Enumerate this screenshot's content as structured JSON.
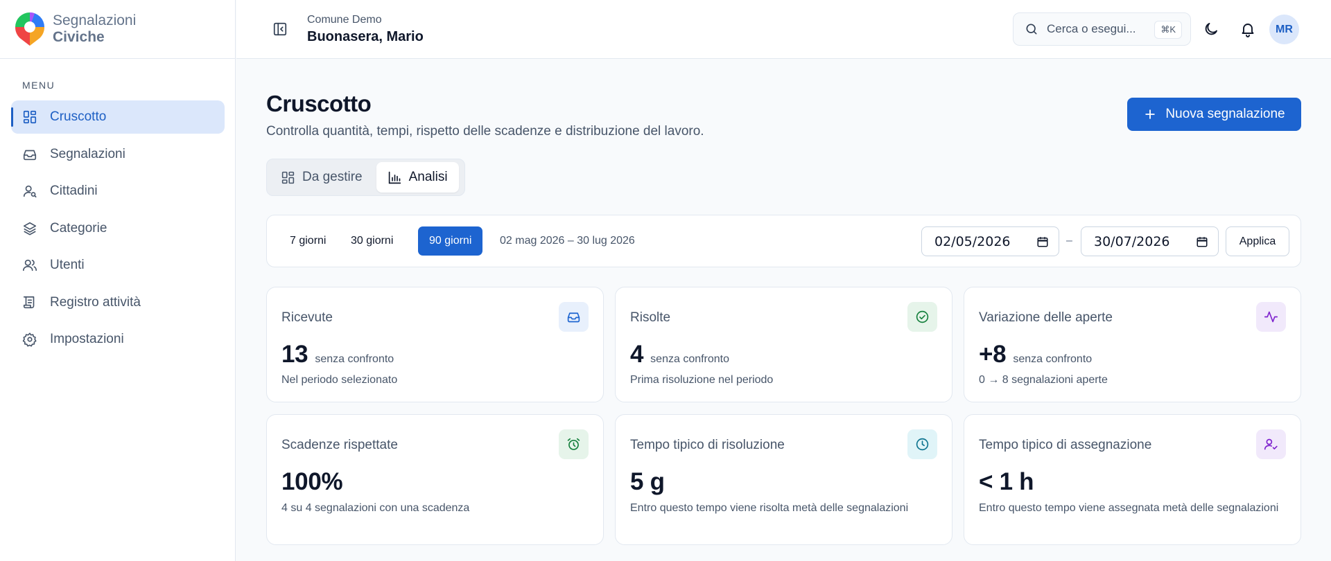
{
  "brand": {
    "line1": "Segnalazioni",
    "line2": "Civiche"
  },
  "sidebar": {
    "menu_label": "MENU",
    "items": [
      {
        "label": "Cruscotto",
        "icon": "dashboard-icon",
        "active": true
      },
      {
        "label": "Segnalazioni",
        "icon": "inbox-icon",
        "active": false
      },
      {
        "label": "Cittadini",
        "icon": "citizen-search-icon",
        "active": false
      },
      {
        "label": "Categorie",
        "icon": "layers-icon",
        "active": false
      },
      {
        "label": "Utenti",
        "icon": "users-icon",
        "active": false
      },
      {
        "label": "Registro attività",
        "icon": "log-scroll-icon",
        "active": false
      },
      {
        "label": "Impostazioni",
        "icon": "gear-icon",
        "active": false
      }
    ]
  },
  "header": {
    "org": "Comune Demo",
    "user": "Buonasera, Mario",
    "search_placeholder": "Cerca o esegui...",
    "shortcut": "⌘K",
    "avatar_initials": "MR"
  },
  "main": {
    "title": "Cruscotto",
    "subtitle": "Controlla quantità, tempi, rispetto delle scadenze e distribuzione del lavoro.",
    "new_button": "Nuova segnalazione",
    "view_tabs": [
      {
        "label": "Da gestire",
        "active": false
      },
      {
        "label": "Analisi",
        "active": true
      }
    ],
    "filter": {
      "ranges": [
        "7 giorni",
        "30 giorni",
        "90 giorni"
      ],
      "active_range": "90 giorni",
      "range_text": "02 mag 2026 – 30 lug 2026",
      "date_from": "02/05/2026",
      "separator": "–",
      "date_to": "30/07/2026",
      "apply": "Applica"
    },
    "cards": [
      {
        "label": "Ricevute",
        "value": "13",
        "badge": "senza confronto",
        "desc": "Nel periodo selezionato",
        "icon": "inbox-icon",
        "accent": "#1d64d0",
        "bg": "#e8f0fc"
      },
      {
        "label": "Risolte",
        "value": "4",
        "badge": "senza confronto",
        "desc": "Prima risoluzione nel periodo",
        "icon": "check-circle-icon",
        "accent": "#15803d",
        "bg": "#e6f4ea"
      },
      {
        "label": "Variazione delle aperte",
        "value": "+8",
        "badge": "senza confronto",
        "desc": "0 → 8 segnalazioni aperte",
        "icon": "activity-icon",
        "accent": "#7e22ce",
        "bg": "#f1e9fb"
      },
      {
        "label": "Scadenze rispettate",
        "value": "100%",
        "badge": "",
        "desc": "4 su 4 segnalazioni con una scadenza",
        "icon": "alarm-clock-icon",
        "accent": "#15803d",
        "bg": "#e6f4ea"
      },
      {
        "label": "Tempo tipico di risoluzione",
        "value": "5 g",
        "badge": "",
        "desc": "Entro questo tempo viene risolta metà delle segnalazioni",
        "icon": "clock-icon",
        "accent": "#0e7490",
        "bg": "#e0f4f8"
      },
      {
        "label": "Tempo tipico di assegnazione",
        "value": "< 1 h",
        "badge": "",
        "desc": "Entro questo tempo viene assegnata metà delle segnalazioni",
        "icon": "user-check-icon",
        "accent": "#7e22ce",
        "bg": "#f1e9fb"
      }
    ]
  }
}
